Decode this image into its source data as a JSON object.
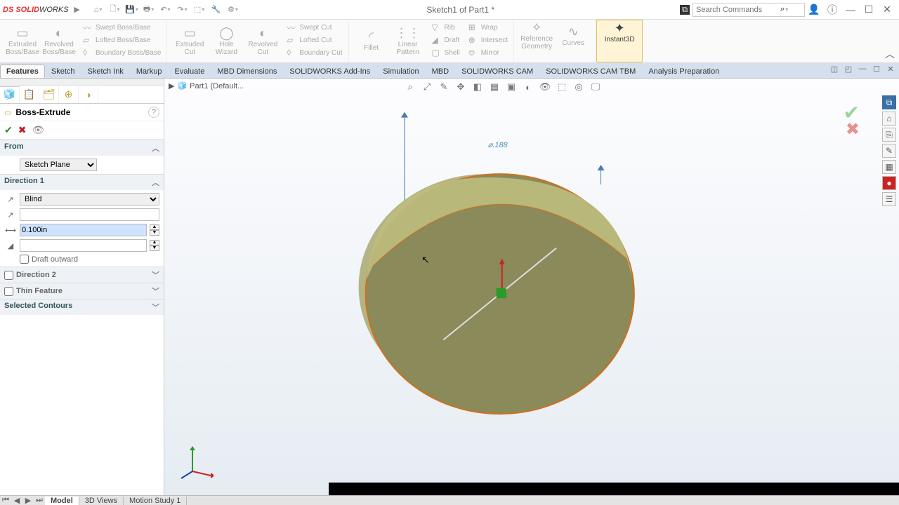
{
  "app": {
    "name_ds": "DS",
    "name_solid": "SOLID",
    "name_works": "WORKS",
    "doc": "Sketch1 of Part1 *"
  },
  "search": {
    "placeholder": "Search Commands",
    "icon": "⌕"
  },
  "win": {
    "min": "—",
    "max": "☐",
    "close": "✕",
    "help": "?",
    "user": "◯"
  },
  "ribbon": {
    "groups": [
      {
        "big": [
          {
            "l1": "Extruded",
            "l2": "Boss/Base",
            "ic": "▭"
          },
          {
            "l1": "Revolved",
            "l2": "Boss/Base",
            "ic": "◐"
          }
        ],
        "small": [
          {
            "ic": "〰",
            "t": "Swept Boss/Base"
          },
          {
            "ic": "▱",
            "t": "Lofted Boss/Base"
          },
          {
            "ic": "◊",
            "t": "Boundary Boss/Base"
          }
        ]
      },
      {
        "big": [
          {
            "l1": "Extruded",
            "l2": "Cut",
            "ic": "▭"
          },
          {
            "l1": "Hole",
            "l2": "Wizard",
            "ic": "◯"
          },
          {
            "l1": "Revolved",
            "l2": "Cut",
            "ic": "◐"
          }
        ],
        "small": [
          {
            "ic": "〰",
            "t": "Swept Cut"
          },
          {
            "ic": "▱",
            "t": "Lofted Cut"
          },
          {
            "ic": "◊",
            "t": "Boundary Cut"
          }
        ]
      },
      {
        "big": [
          {
            "l1": "Fillet",
            "l2": "",
            "ic": "◜"
          },
          {
            "l1": "Linear",
            "l2": "Pattern",
            "ic": "⋮⋮"
          }
        ],
        "small": [
          {
            "ic": "▽",
            "t": "Rib"
          },
          {
            "ic": "◢",
            "t": "Draft"
          },
          {
            "ic": "▢",
            "t": "Shell"
          },
          {
            "ic": "⊞",
            "t": "Wrap"
          },
          {
            "ic": "⊗",
            "t": "Intersect"
          },
          {
            "ic": "⎊",
            "t": "Mirror"
          }
        ]
      },
      {
        "big": [
          {
            "l1": "Reference",
            "l2": "Geometry",
            "ic": "✧"
          },
          {
            "l1": "Curves",
            "l2": "",
            "ic": "∿"
          }
        ],
        "small": []
      },
      {
        "big": [
          {
            "l1": "Instant3D",
            "l2": "",
            "ic": "✦"
          }
        ],
        "small": [],
        "active": true
      }
    ]
  },
  "cmdtabs": [
    "Features",
    "Sketch",
    "Sketch Ink",
    "Markup",
    "Evaluate",
    "MBD Dimensions",
    "SOLIDWORKS Add-Ins",
    "Simulation",
    "MBD",
    "SOLIDWORKS CAM",
    "SOLIDWORKS CAM TBM",
    "Analysis Preparation"
  ],
  "cmdtabs_sel": 0,
  "breadcrumb": {
    "part": "Part1 (Default..."
  },
  "pm": {
    "title": "Boss-Extrude",
    "from_label": "From",
    "from_value": "Sketch Plane",
    "dir1_label": "Direction 1",
    "dir1_end": "Blind",
    "depth": "0.100in",
    "draft_label": "Draft outward",
    "dir2_label": "Direction 2",
    "thin_label": "Thin Feature",
    "selcont_label": "Selected Contours"
  },
  "dim": {
    "diameter": "⌀.188"
  },
  "vtool": [
    "⌕",
    "⤢",
    "✎",
    "✥",
    "◧",
    "▦",
    "▣",
    "◐",
    "👁",
    "⬚",
    "◎",
    "🖵"
  ],
  "rbar": [
    "⌂",
    "⎘",
    "✎",
    "▦",
    "●",
    "☰"
  ],
  "btabs": {
    "items": [
      "Model",
      "3D Views",
      "Motion Study 1"
    ],
    "sel": 0
  }
}
